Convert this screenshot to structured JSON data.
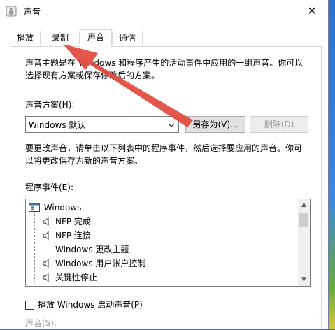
{
  "window": {
    "title": "声音",
    "close_glyph": "✕"
  },
  "tabs": [
    {
      "label": "播放"
    },
    {
      "label": "录制"
    },
    {
      "label": "声音"
    },
    {
      "label": "通信"
    }
  ],
  "description": {
    "line1": "声音主题是在 Windows 和程序产生的活动事件中应用的一组声音。你可以",
    "line2": "选择现有方案或保存修改后的方案。"
  },
  "scheme": {
    "label": "声音方案(H):",
    "selected": "Windows 默认",
    "save_as_button": "另存为(V)...",
    "delete_button": "删除(D)"
  },
  "instruction": {
    "line1": "要更改声音，请单击以下列表中的程序事件，然后选择要应用的声音。你可",
    "line2": "以将更改保存为新的声音方案。"
  },
  "program_events": {
    "label": "程序事件(E):",
    "root": "Windows",
    "items": [
      {
        "label": "NFP 完成",
        "has_sound": true
      },
      {
        "label": "NFP 连接",
        "has_sound": true
      },
      {
        "label": "Windows 更改主题",
        "has_sound": false
      },
      {
        "label": "Windows 用户帐户控制",
        "has_sound": true
      },
      {
        "label": "关键性停止",
        "has_sound": true
      }
    ]
  },
  "startup_sound": {
    "label": "播放 Windows 启动声音(P)",
    "checked": false
  },
  "sounds_label": "声音(S):",
  "colors": {
    "annotation_arrow": "#e2473b",
    "disabled_text": "#a0a0a0"
  }
}
